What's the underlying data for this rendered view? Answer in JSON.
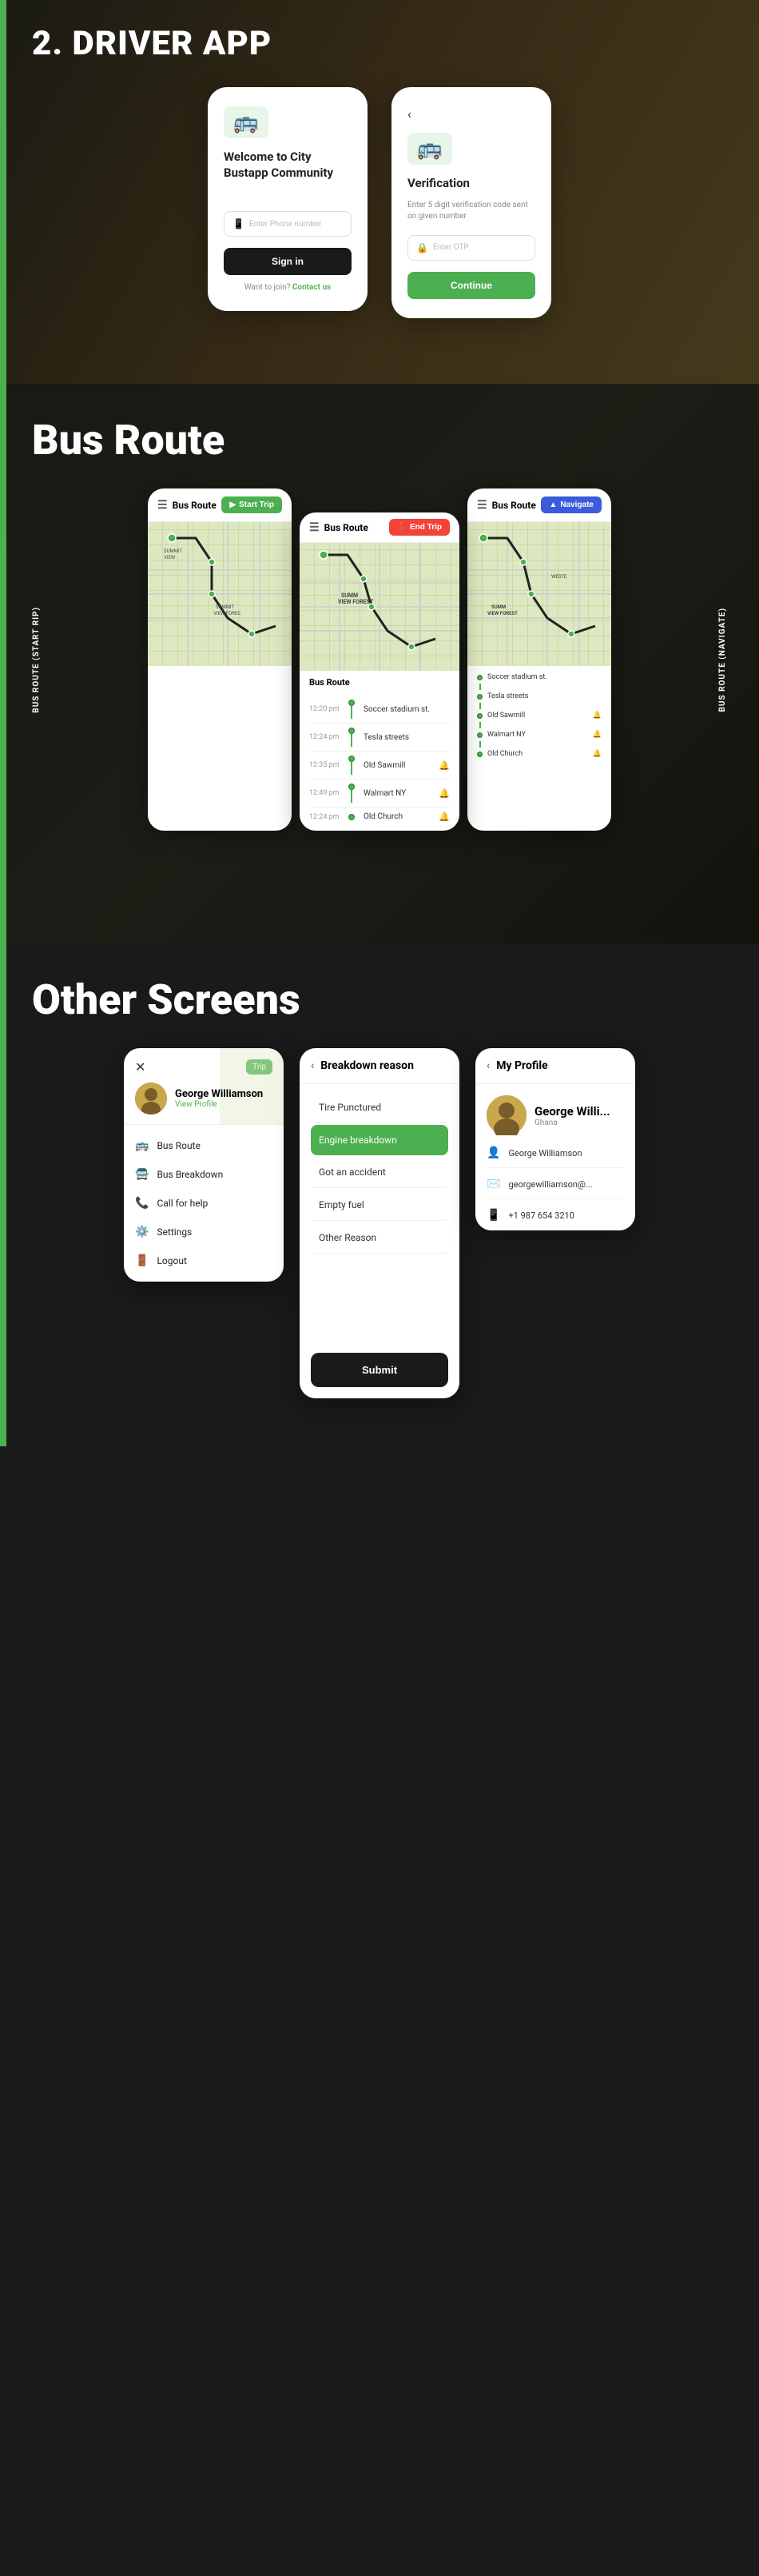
{
  "header": {
    "title": "2. DRIVER APP"
  },
  "login_screen": {
    "logo_icon": "🚌",
    "welcome_text": "Welcome to City Bustapp Community",
    "phone_placeholder": "Enter Phone number",
    "signin_label": "Sign in",
    "want_join": "Want to join?",
    "contact_label": "Contact us"
  },
  "verification_screen": {
    "back_arrow": "‹",
    "logo_icon": "🚌",
    "title": "Verification",
    "subtitle": "Enter 5 digit verification code sent on given number",
    "otp_placeholder": "Enter OTP",
    "continue_label": "Continue"
  },
  "bus_route_section": {
    "title": "Bus Route",
    "left_label": "Bus Route (Start rip)",
    "right_label": "Bus route (Navigate)",
    "bottom_label": "End Trip",
    "start_trip_label": "Start Trip",
    "navigate_label": "Navigate",
    "end_trip_label": "End Trip",
    "route_name": "Bus Route",
    "stops": [
      {
        "time": "12:20 pm",
        "name": "Soccer stadium st."
      },
      {
        "time": "12:24 pm",
        "name": "Tesla streets"
      },
      {
        "time": "12:35 pm",
        "name": "Old Sawmill"
      },
      {
        "time": "12:49 pm",
        "name": "Walmart NY"
      },
      {
        "time": "12:24 pm",
        "name": "Old Church"
      }
    ],
    "mini_stops": [
      {
        "name": "Soccer stadium st."
      },
      {
        "name": "Tesla streets"
      },
      {
        "name": "Old Sawmill"
      },
      {
        "name": "Walmart NY"
      },
      {
        "name": "Old Church"
      }
    ]
  },
  "other_screens": {
    "title": "Other Screens",
    "menu": {
      "close_icon": "✕",
      "trip_label": "Trip",
      "driver_name": "George Williamson",
      "view_profile": "View Profile",
      "items": [
        {
          "icon": "🚌",
          "label": "Bus Route"
        },
        {
          "icon": "🚍",
          "label": "Bus Breakdown"
        },
        {
          "icon": "📞",
          "label": "Call for help"
        },
        {
          "icon": "⚙️",
          "label": "Settings"
        },
        {
          "icon": "🚪",
          "label": "Logout"
        }
      ]
    },
    "breakdown": {
      "back_arrow": "‹",
      "title": "Breakdown reason",
      "options": [
        {
          "label": "Tire Punctured",
          "active": false
        },
        {
          "label": "Engine breakdown",
          "active": true
        },
        {
          "label": "Got an accident",
          "active": false
        },
        {
          "label": "Empty fuel",
          "active": false
        },
        {
          "label": "Other Reason",
          "active": false
        }
      ],
      "submit_label": "Submit"
    },
    "profile": {
      "back_arrow": "‹",
      "title": "My Profile",
      "driver_name": "George Williamson",
      "driver_name_short": "George Willi...",
      "status": "Ghana",
      "details": [
        {
          "icon": "👤",
          "text": "George Williamson"
        },
        {
          "icon": "✉️",
          "text": "georgewilliamson@..."
        },
        {
          "icon": "📱",
          "text": "+1 987 654 3210"
        }
      ]
    }
  }
}
